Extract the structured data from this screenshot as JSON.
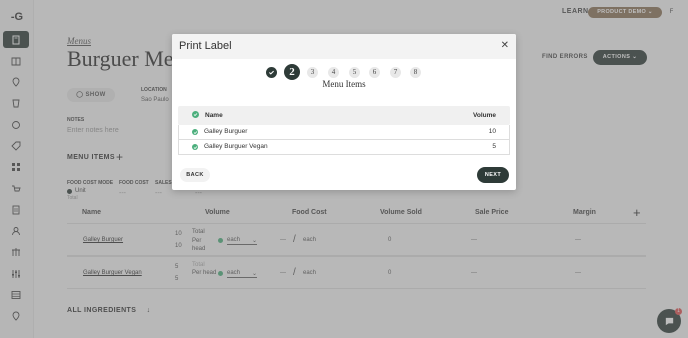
{
  "topbar": {
    "learn_label": "LEARN",
    "product_demo_label": "PRODUCT DEMO",
    "avatar_initial": "F"
  },
  "sidebar": {
    "logo_text": "-G"
  },
  "page": {
    "breadcrumb": "Menus",
    "title": "Burguer Menu",
    "find_errors_label": "FIND ERRORS",
    "actions_label": "ACTIONS",
    "show_label": "SHOW",
    "location_label": "LOCATION",
    "location_value": "Sao Paulo",
    "notes_label": "NOTES",
    "notes_placeholder": "Enter notes here",
    "menu_items_label": "MENU ITEMS",
    "food_cost_mode_label": "FOOD COST MODE",
    "food_cost_label": "FOOD COST",
    "sales_label": "SALES",
    "mode_unit": "Unit",
    "mode_total": "Total",
    "dash": "---",
    "all_ingredients_label": "ALL INGREDIENTS",
    "columns": [
      "Name",
      "Volume",
      "Food Cost",
      "Volume Sold",
      "Sale Price",
      "Margin"
    ],
    "rows": [
      {
        "name": "Galley Burguer",
        "vol1": "10",
        "vol2": "10",
        "mode1": "Total",
        "mode2": "Per head",
        "unit": "each",
        "food_cost": "---",
        "per": "each",
        "volume_sold": "0",
        "sale_price": "---",
        "margin": "---"
      },
      {
        "name": "Galley Burguer Vegan",
        "vol1": "5",
        "vol2": "5",
        "mode1": "Total",
        "mode2": "Per head",
        "unit": "each",
        "food_cost": "---",
        "per": "each",
        "volume_sold": "0",
        "sale_price": "---",
        "margin": "---"
      }
    ],
    "chat_badge": "1"
  },
  "modal": {
    "title": "Print Label",
    "steps": [
      "",
      "2",
      "3",
      "4",
      "5",
      "6",
      "7",
      "8"
    ],
    "current_step": 2,
    "step_caption": "Menu Items",
    "table_header_name": "Name",
    "table_header_volume": "Volume",
    "items": [
      {
        "name": "Galley Burguer",
        "volume": "10"
      },
      {
        "name": "Galley Burguer Vegan",
        "volume": "5"
      }
    ],
    "back_label": "BACK",
    "next_label": "NEXT"
  },
  "colors": {
    "primary": "#2e3b38",
    "accent": "#8b7358",
    "check_green": "#4caf7d"
  }
}
